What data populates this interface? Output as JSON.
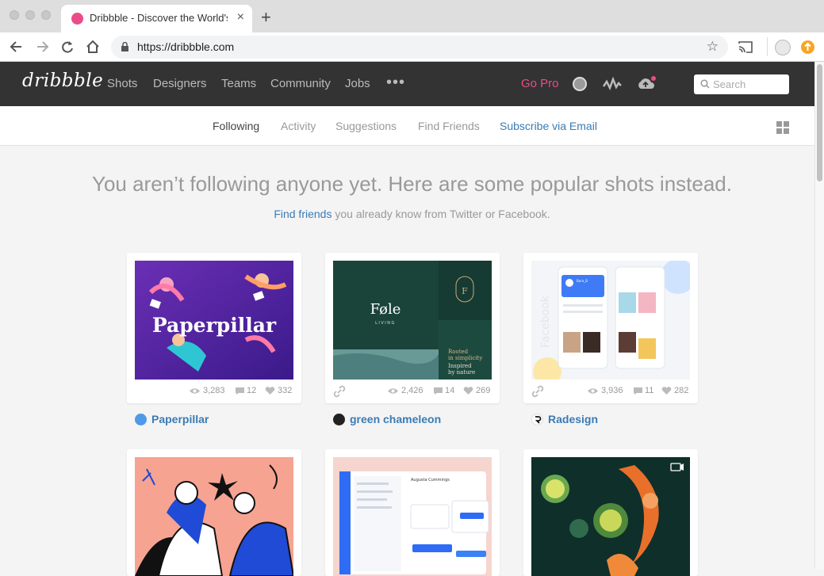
{
  "browser": {
    "tab_title": "Dribbble - Discover the World's",
    "tab_close": "×",
    "new_tab": "+",
    "url": "https://dribbble.com",
    "star": "☆"
  },
  "site": {
    "logo": "dribbble",
    "nav": [
      "Shots",
      "Designers",
      "Teams",
      "Community",
      "Jobs"
    ],
    "more": "•••",
    "go_pro": "Go Pro",
    "search_placeholder": "Search"
  },
  "subnav": {
    "items": [
      "Following",
      "Activity",
      "Suggestions",
      "Find Friends",
      "Subscribe via Email"
    ]
  },
  "main": {
    "headline": "You aren’t following anyone yet. Here are some popular shots instead.",
    "find_friends": "Find friends",
    "subline_rest": " you already know from Twitter or Facebook."
  },
  "shots": [
    {
      "title_art": "Paperpillar",
      "views": "3,283",
      "comments": "12",
      "likes": "332",
      "author": "Paperpillar",
      "has_link": false
    },
    {
      "title_art": "Føle",
      "views": "2,426",
      "comments": "14",
      "likes": "269",
      "author": "green chameleon",
      "has_link": true
    },
    {
      "title_art": "Facebook",
      "views": "3,936",
      "comments": "11",
      "likes": "282",
      "author": "Radesign",
      "has_link": true
    }
  ],
  "art": {
    "fole_sub": "LIVING",
    "fole_tag1": "Rooted",
    "fole_tag2": "in simplicity",
    "fole_tag3": "Inspired",
    "fole_tag4": "by nature",
    "radesign_name": "Bora_B",
    "dash_title": "Augusta Cummings"
  },
  "colors": {
    "header_bg": "#333333",
    "accent_pink": "#ea4c89",
    "link_blue": "#3a7bb5"
  }
}
